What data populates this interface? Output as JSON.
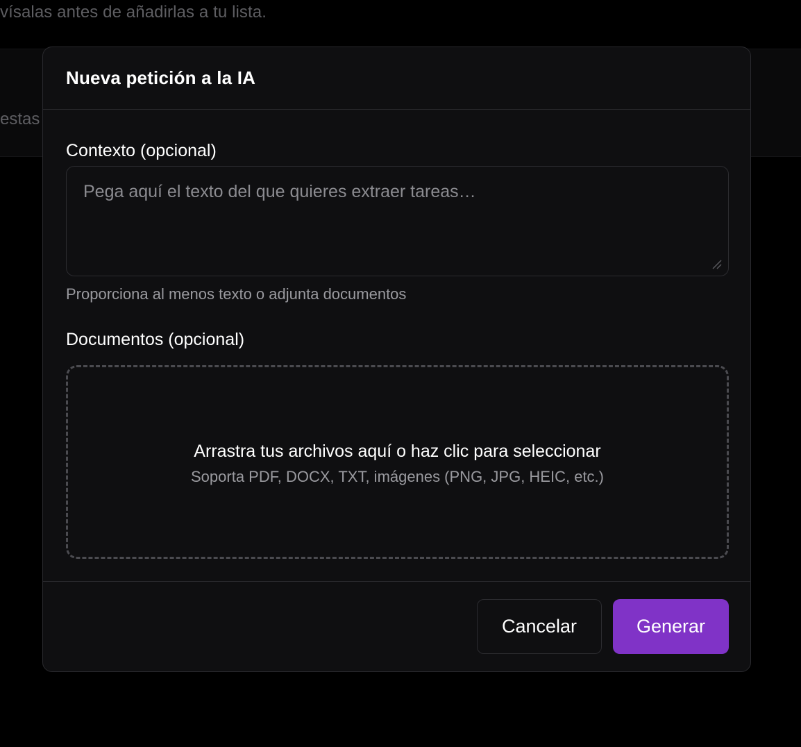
{
  "background": {
    "subtitle": "vísalas antes de añadirlas a tu lista.",
    "truncated_text": "estas"
  },
  "modal": {
    "title": "Nueva petición a la IA",
    "context": {
      "label": "Contexto (opcional)",
      "value": "",
      "placeholder": "Pega aquí el texto del que quieres extraer tareas…",
      "helper": "Proporciona al menos texto o adjunta documentos"
    },
    "documents": {
      "label": "Documentos (opcional)",
      "dropzone_title": "Arrastra tus archivos aquí o haz clic para seleccionar",
      "dropzone_subtitle": "Soporta PDF, DOCX, TXT, imágenes (PNG, JPG, HEIC, etc.)"
    },
    "footer": {
      "cancel_label": "Cancelar",
      "generate_label": "Generar"
    }
  },
  "colors": {
    "accent": "#8033c7",
    "modal_background": "#0f0f11",
    "page_background": "#000000",
    "border": "#2a2a2e",
    "muted_text": "#9a9a9f"
  },
  "icons": {
    "textarea_resize": "resize-grip-icon"
  }
}
